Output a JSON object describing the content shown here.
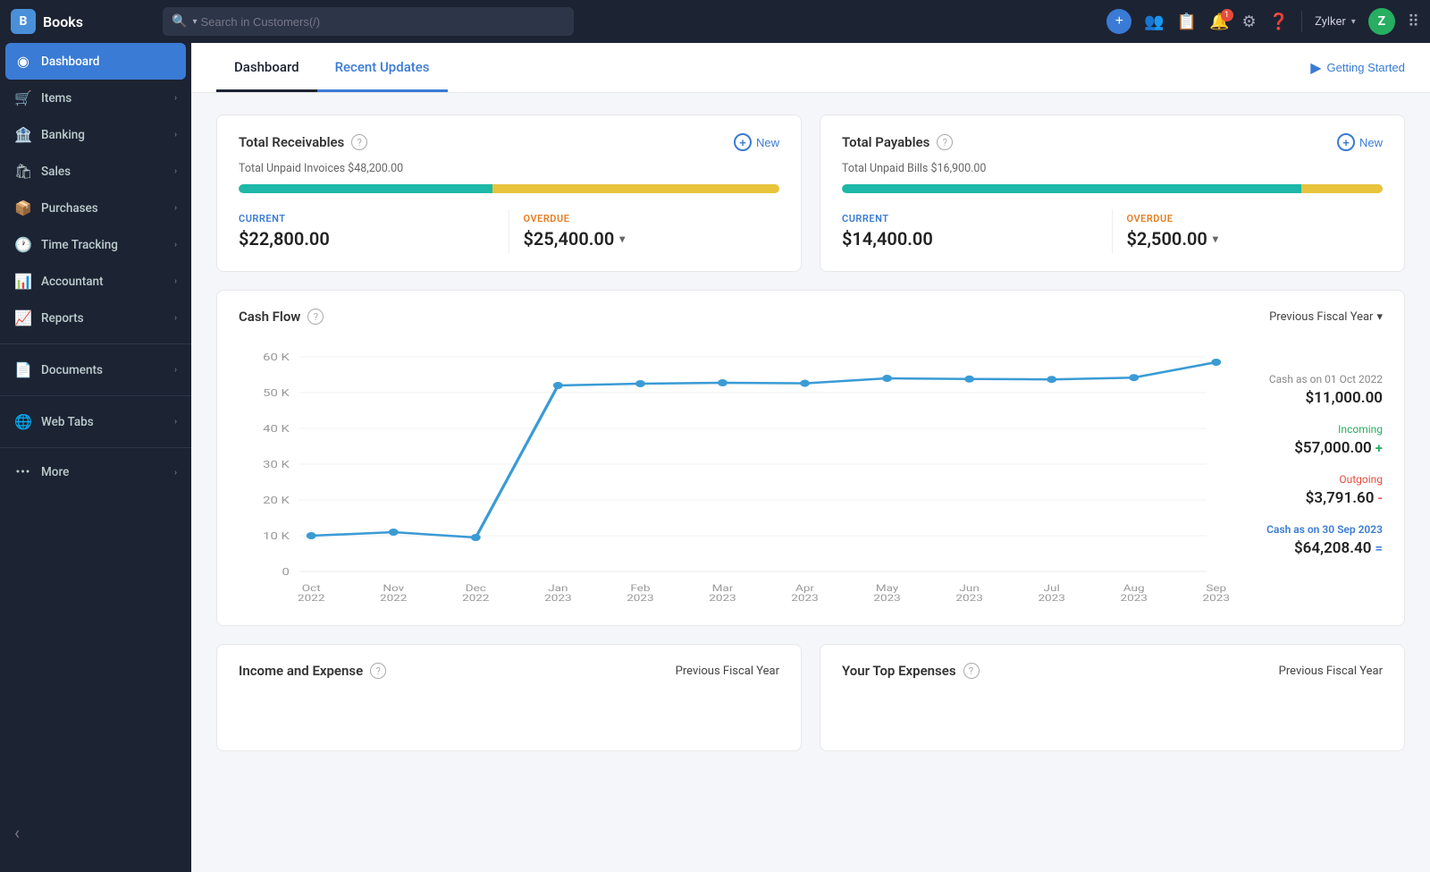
{
  "app": {
    "name": "Books",
    "brand_letter": "B"
  },
  "topnav": {
    "search_placeholder": "Search in Customers(/)",
    "user_name": "Zylker",
    "user_initial": "Z",
    "getting_started_label": "Getting Started"
  },
  "sidebar": {
    "items": [
      {
        "id": "dashboard",
        "label": "Dashboard",
        "icon": "⊙",
        "active": true,
        "has_children": false
      },
      {
        "id": "items",
        "label": "Items",
        "icon": "🛒",
        "active": false,
        "has_children": true
      },
      {
        "id": "banking",
        "label": "Banking",
        "icon": "🏦",
        "active": false,
        "has_children": true
      },
      {
        "id": "sales",
        "label": "Sales",
        "icon": "🛍",
        "active": false,
        "has_children": true
      },
      {
        "id": "purchases",
        "label": "Purchases",
        "icon": "📦",
        "active": false,
        "has_children": true
      },
      {
        "id": "time-tracking",
        "label": "Time Tracking",
        "icon": "🕐",
        "active": false,
        "has_children": true
      },
      {
        "id": "accountant",
        "label": "Accountant",
        "icon": "📊",
        "active": false,
        "has_children": true
      },
      {
        "id": "reports",
        "label": "Reports",
        "icon": "📈",
        "active": false,
        "has_children": true
      },
      {
        "id": "documents",
        "label": "Documents",
        "icon": "📄",
        "active": false,
        "has_children": true
      },
      {
        "id": "web-tabs",
        "label": "Web Tabs",
        "icon": "🌐",
        "active": false,
        "has_children": true
      },
      {
        "id": "more",
        "label": "More",
        "icon": "···",
        "active": false,
        "has_children": true
      }
    ],
    "collapse_icon": "‹"
  },
  "dashboard": {
    "tab_dashboard": "Dashboard",
    "tab_recent_updates": "Recent Updates",
    "total_receivables": {
      "title": "Total Receivables",
      "new_label": "New",
      "subtitle": "Total Unpaid Invoices $48,200.00",
      "current_label": "CURRENT",
      "current_value": "$22,800.00",
      "overdue_label": "OVERDUE",
      "overdue_value": "$25,400.00",
      "current_pct": 47,
      "overdue_pct": 53
    },
    "total_payables": {
      "title": "Total Payables",
      "new_label": "New",
      "subtitle": "Total Unpaid Bills $16,900.00",
      "current_label": "CURRENT",
      "current_value": "$14,400.00",
      "overdue_label": "OVERDUE",
      "overdue_value": "$2,500.00",
      "current_pct": 85,
      "overdue_pct": 15
    },
    "cash_flow": {
      "title": "Cash Flow",
      "period": "Previous Fiscal Year",
      "cash_as_on_start_label": "Cash as on 01 Oct 2022",
      "cash_as_on_start_value": "$11,000.00",
      "incoming_label": "Incoming",
      "incoming_value": "$57,000.00",
      "outgoing_label": "Outgoing",
      "outgoing_value": "$3,791.60",
      "cash_as_on_end_label": "Cash as on 30 Sep 2023",
      "cash_as_on_end_value": "$64,208.40",
      "chart": {
        "x_labels": [
          "Oct\n2022",
          "Nov\n2022",
          "Dec\n2022",
          "Jan\n2023",
          "Feb\n2023",
          "Mar\n2023",
          "Apr\n2023",
          "May\n2023",
          "Jun\n2023",
          "Jul\n2023",
          "Aug\n2023",
          "Sep\n2023"
        ],
        "y_labels": [
          "60 K",
          "50 K",
          "40 K",
          "30 K",
          "20 K",
          "10 K",
          "0"
        ],
        "data_points": [
          10000,
          11000,
          9500,
          52000,
          52500,
          52800,
          52600,
          54000,
          53800,
          53700,
          54200,
          58500,
          58800
        ]
      }
    },
    "income_expense": {
      "title": "Income and Expense",
      "period": "Previous Fiscal Year"
    },
    "top_expenses": {
      "title": "Your Top Expenses",
      "period": "Previous Fiscal Year"
    }
  }
}
